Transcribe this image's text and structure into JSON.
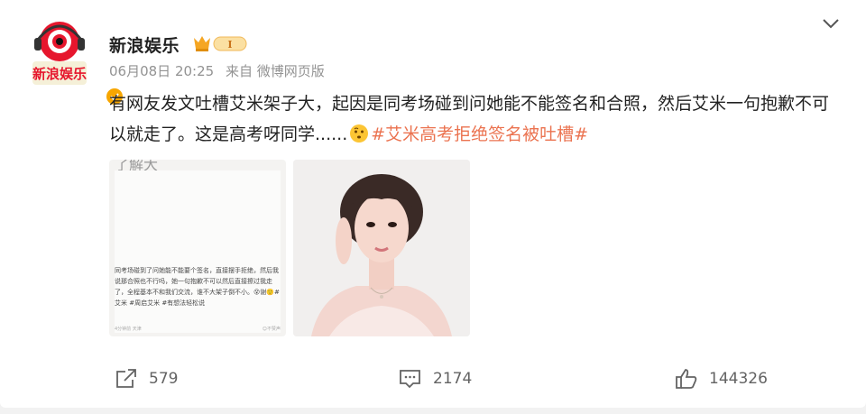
{
  "post": {
    "author": "新浪娱乐",
    "date": "06月08日 20:25",
    "source": "来自 微博网页版",
    "text_part1": "有网友发文吐槽艾米架子大，起因是同考场碰到问她能不能签名和合照，然后艾米一句抱歉不可以就走了。这是高考呀同学......",
    "hashtag": "#艾米高考拒绝签名被吐槽#",
    "avatar_lettering": "新浪娱乐",
    "vip_badge": "I"
  },
  "images": {
    "screenshot": {
      "top_text": "了解大",
      "body": "同考场碰到了问她能不能要个签名，直接摆手拒绝，然后我说那合照也不行吗，她一句抱歉不可以然后直接擦过我走了，全程基本不和我们交流，谁不大架子倒不小。😵谢🙂#艾米 #周启艾米 #有想法轻松说",
      "footer_left": "4分钟前 天津",
      "footer_right": "☺不赞声"
    }
  },
  "actions": {
    "repost_count": "579",
    "comment_count": "2174",
    "like_count": "144326"
  },
  "colors": {
    "hashtag": "#eb7350",
    "meta": "#939393",
    "badge": "#f7a600"
  },
  "icons": [
    "avatar-logo",
    "verified-icon",
    "vip-crown-icon",
    "chevron-down-icon",
    "thinking-emoji-icon",
    "repost-icon",
    "comment-icon",
    "like-icon"
  ]
}
